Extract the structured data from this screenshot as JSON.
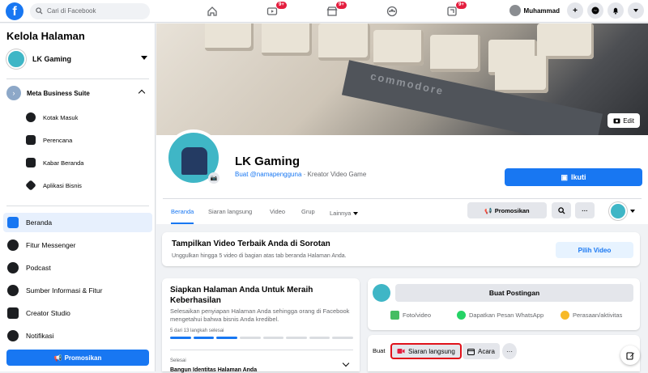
{
  "colors": {
    "brand": "#1877f2",
    "badge": "#e41e3f",
    "highlight": "#e0121b"
  },
  "topbar": {
    "search_placeholder": "Cari di Facebook",
    "badges": [
      "9+",
      "9+",
      "9+"
    ],
    "user_name": "Muhammad"
  },
  "sidebar": {
    "title": "Kelola Halaman",
    "page_name": "LK Gaming",
    "mbs_label": "Meta Business Suite",
    "sub_items": [
      "Kotak Masuk",
      "Perencana",
      "Kabar Beranda",
      "Aplikasi Bisnis"
    ],
    "nav_items": [
      "Beranda",
      "Fitur Messenger",
      "Podcast",
      "Sumber Informasi & Fitur",
      "Creator Studio",
      "Notifikasi"
    ],
    "promote_label": "Promosikan"
  },
  "cover": {
    "brand_text": "commodore",
    "edit_label": "Edit"
  },
  "profile": {
    "name": "LK Gaming",
    "username_link": "Buat @namapengguna",
    "category": " · Kreator Video Game",
    "follow_label": "Ikuti"
  },
  "tabs": [
    "Beranda",
    "Siaran langsung",
    "Video",
    "Grup",
    "Lainnya"
  ],
  "actions": {
    "promote_label": "Promosikan",
    "more_label": "···"
  },
  "featured": {
    "title": "Tampilkan Video Terbaik Anda di Sorotan",
    "desc": "Unggulkan hingga 5 video di bagian atas tab beranda Halaman Anda.",
    "button": "Pilih Video"
  },
  "setup": {
    "title": "Siapkan Halaman Anda Untuk Meraih Keberhasilan",
    "desc": "Selesaikan penyiapan Halaman Anda sehingga orang di Facebook mengetahui bahwa bisnis Anda kredibel.",
    "steps_text": "5 dari 13 langkah selesai",
    "steps_done": 5,
    "steps_total": 13,
    "done_label": "Selesai",
    "next_label": "Bangun Identitas Halaman Anda"
  },
  "composer": {
    "post_label": "Buat Postingan",
    "photo_label": "Foto/video",
    "whatsapp_label": "Dapatkan Pesan WhatsApp",
    "feeling_label": "Perasaan/aktivitas"
  },
  "create_bar": {
    "buat_label": "Buat",
    "live_label": "Siaran langsung",
    "event_label": "Acara",
    "more_label": "···"
  }
}
